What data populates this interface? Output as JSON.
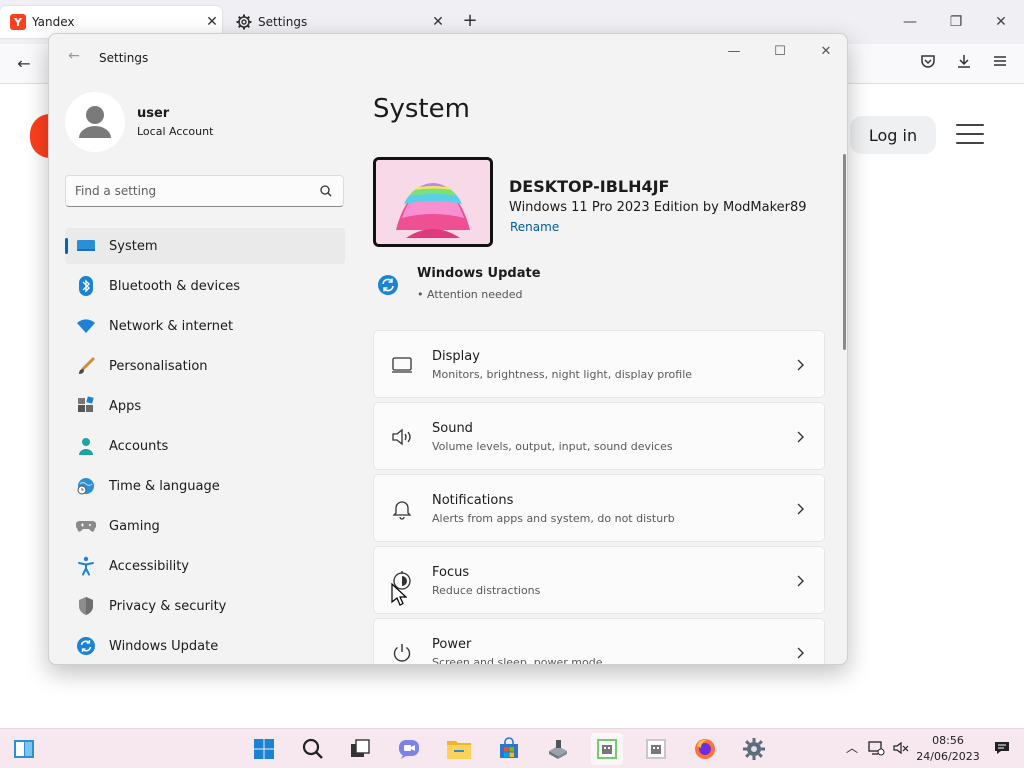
{
  "browser": {
    "tabs": [
      {
        "title": "Yandex",
        "active": true
      },
      {
        "title": "Settings",
        "active": false
      }
    ],
    "new_tab": "+",
    "window_controls": {
      "minimize": "—",
      "restore": "❐",
      "close": "✕"
    }
  },
  "yandex_page": {
    "login_label": "Log in"
  },
  "settings": {
    "window_title": "Settings",
    "user": {
      "name": "user",
      "account_type": "Local Account"
    },
    "search": {
      "placeholder": "Find a setting",
      "value": ""
    },
    "nav": [
      {
        "label": "System",
        "icon": "monitor-icon",
        "selected": true
      },
      {
        "label": "Bluetooth & devices",
        "icon": "bluetooth-icon"
      },
      {
        "label": "Network & internet",
        "icon": "wifi-icon"
      },
      {
        "label": "Personalisation",
        "icon": "brush-icon"
      },
      {
        "label": "Apps",
        "icon": "apps-icon"
      },
      {
        "label": "Accounts",
        "icon": "person-icon"
      },
      {
        "label": "Time & language",
        "icon": "globe-clock-icon"
      },
      {
        "label": "Gaming",
        "icon": "gamepad-icon"
      },
      {
        "label": "Accessibility",
        "icon": "accessibility-icon"
      },
      {
        "label": "Privacy & security",
        "icon": "shield-icon"
      },
      {
        "label": "Windows Update",
        "icon": "update-icon"
      }
    ],
    "page_title": "System",
    "device": {
      "name": "DESKTOP-IBLH4JF",
      "os": "Windows 11 Pro 2023 Edition by ModMaker89",
      "rename_label": "Rename"
    },
    "windows_update": {
      "title": "Windows Update",
      "status": "Attention needed"
    },
    "cards": [
      {
        "title": "Display",
        "subtitle": "Monitors, brightness, night light, display profile",
        "icon": "display-icon"
      },
      {
        "title": "Sound",
        "subtitle": "Volume levels, output, input, sound devices",
        "icon": "speaker-icon"
      },
      {
        "title": "Notifications",
        "subtitle": "Alerts from apps and system, do not disturb",
        "icon": "bell-icon"
      },
      {
        "title": "Focus",
        "subtitle": "Reduce distractions",
        "icon": "focus-icon"
      },
      {
        "title": "Power",
        "subtitle": "Screen and sleep, power mode",
        "icon": "power-icon"
      }
    ]
  },
  "taskbar": {
    "time": "08:56",
    "date": "24/06/2023"
  },
  "colors": {
    "accent": "#0067c0",
    "yandex_red": "#fc3f1d",
    "taskbar_bg": "#f7e8ef"
  }
}
